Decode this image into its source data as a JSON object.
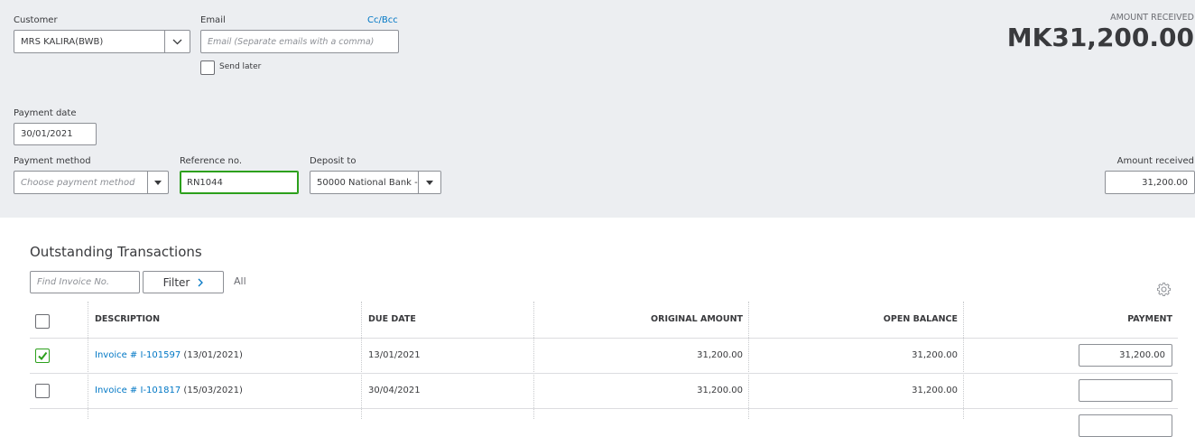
{
  "customer": {
    "label": "Customer",
    "value": "MRS KALIRA(BWB)"
  },
  "email": {
    "label": "Email",
    "cc_bcc": "Cc/Bcc",
    "placeholder": "Email (Separate emails with a comma)",
    "send_later": "Send later"
  },
  "amount_header": {
    "label": "AMOUNT RECEIVED",
    "value": "MK31,200.00"
  },
  "payment_date": {
    "label": "Payment date",
    "value": "30/01/2021"
  },
  "payment_method": {
    "label": "Payment method",
    "placeholder": "Choose payment method"
  },
  "reference": {
    "label": "Reference no.",
    "value": "RN1044"
  },
  "deposit_to": {
    "label": "Deposit to",
    "value": "50000 National Bank -"
  },
  "amount_received": {
    "label": "Amount received",
    "value": "31,200.00"
  },
  "outstanding": {
    "title": "Outstanding Transactions",
    "find_placeholder": "Find Invoice No.",
    "filter_label": "Filter",
    "all_label": "All",
    "columns": [
      "DESCRIPTION",
      "DUE DATE",
      "ORIGINAL AMOUNT",
      "OPEN BALANCE",
      "PAYMENT"
    ],
    "rows": [
      {
        "checked": true,
        "invoice_link": "Invoice # I-101597",
        "invoice_date": "(13/01/2021)",
        "due_date": "13/01/2021",
        "original_amount": "31,200.00",
        "open_balance": "31,200.00",
        "payment": "31,200.00"
      },
      {
        "checked": false,
        "invoice_link": "Invoice # I-101817",
        "invoice_date": "(15/03/2021)",
        "due_date": "30/04/2021",
        "original_amount": "31,200.00",
        "open_balance": "31,200.00",
        "payment": ""
      }
    ]
  },
  "colors": {
    "panel_bg": "#eceef1",
    "link": "#0077c5",
    "check_green": "#2ca01c",
    "focus_green": "#2ca01c"
  },
  "icons": [
    "chevron-down-icon",
    "caret-down-icon",
    "chevron-right-icon",
    "gear-icon",
    "checkmark-icon"
  ]
}
